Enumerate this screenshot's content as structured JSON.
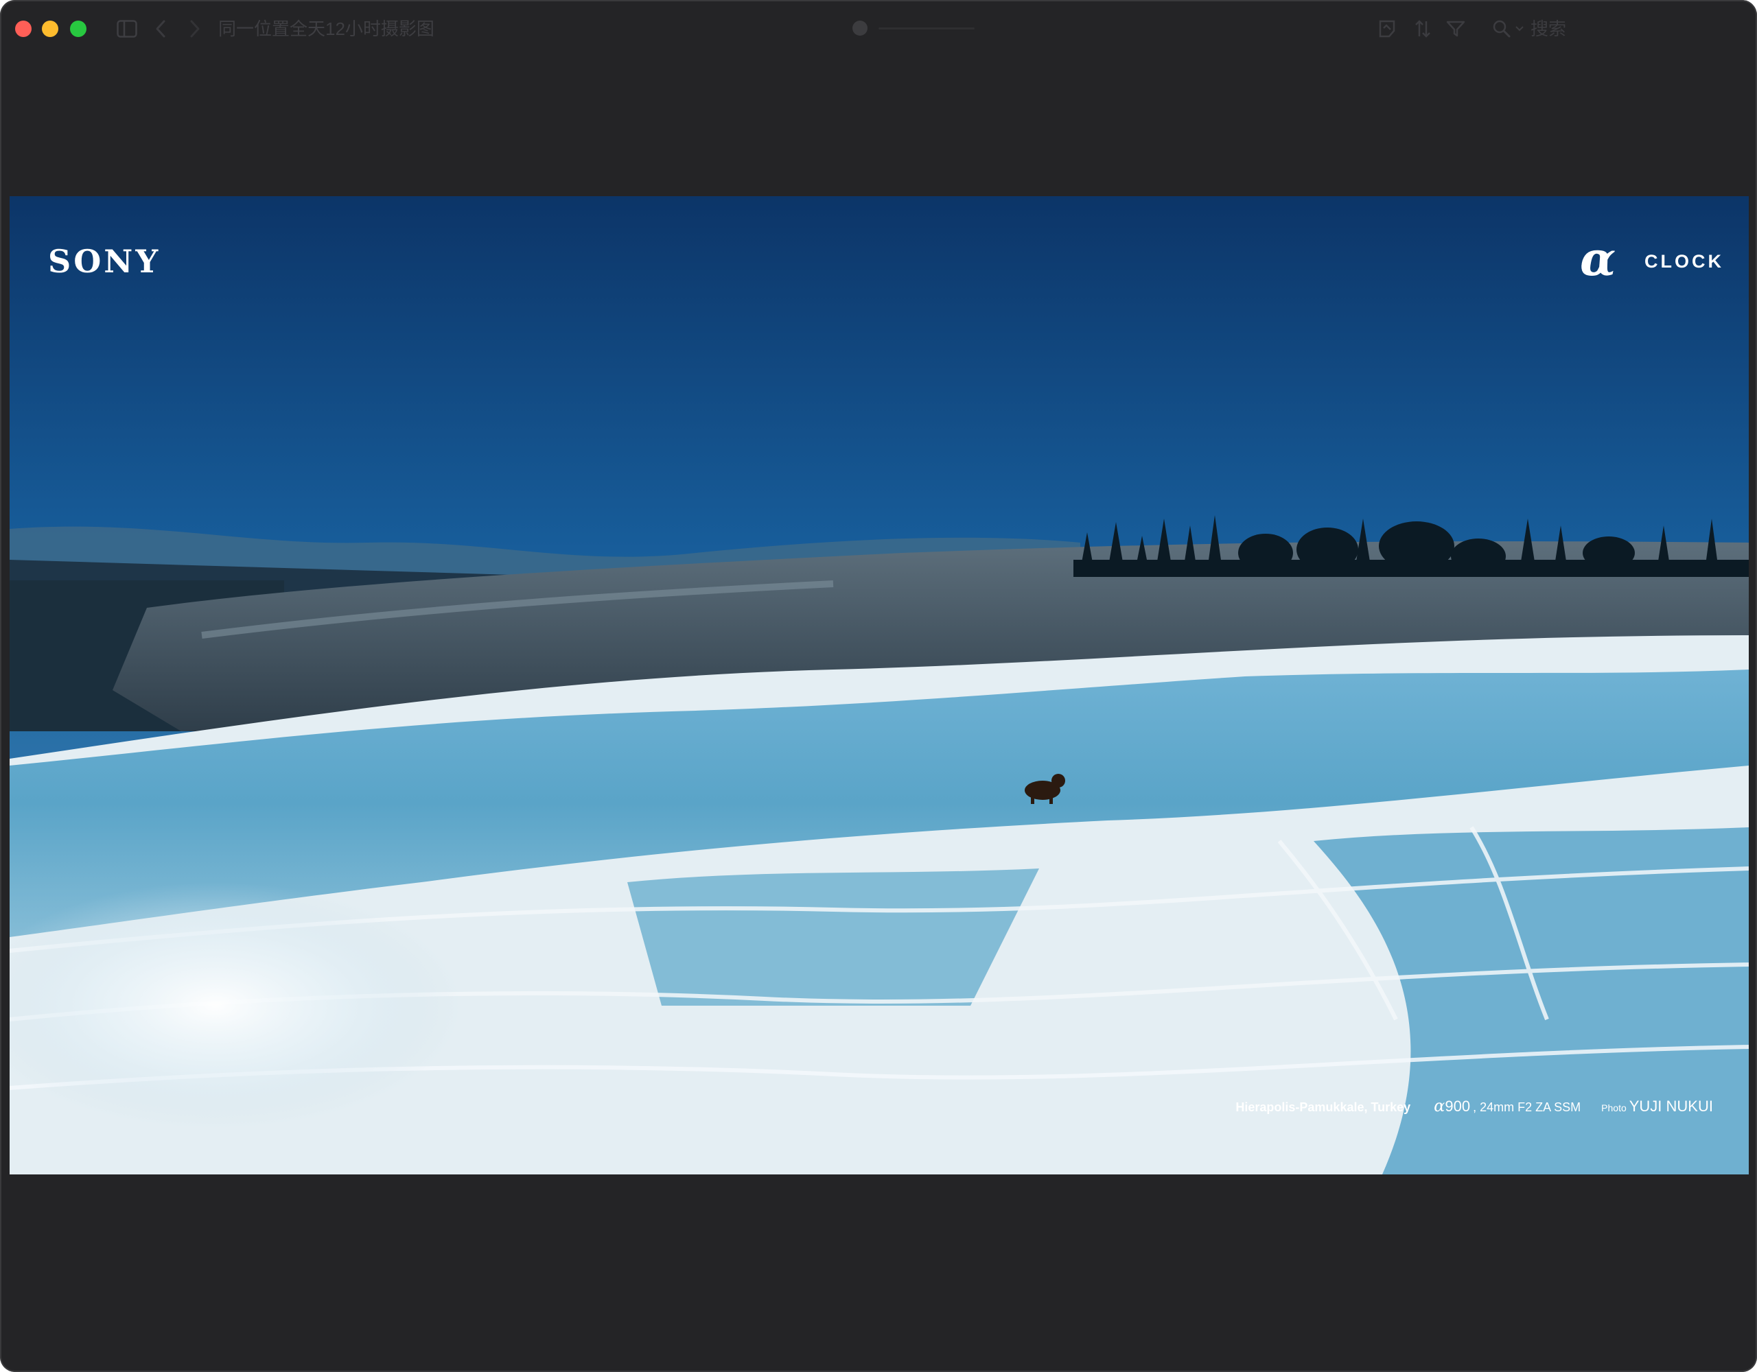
{
  "window": {
    "title": "同一位置全天12小时摄影图",
    "search": {
      "placeholder": "搜索",
      "value": ""
    }
  },
  "toolbar": {
    "icons": [
      "sidebar-toggle-icon",
      "back-icon",
      "forward-icon",
      "markup-icon",
      "sort-icon",
      "filter-icon",
      "search-icon"
    ]
  },
  "photo": {
    "brand": "SONY",
    "logo_alpha": "α",
    "logo_text": "CLOCK",
    "caption": {
      "location": "Hierapolis-Pamukkale, Turkey",
      "alpha": "α",
      "model": "900",
      "lens": ", 24mm F2 ZA SSM",
      "photo_label": "Photo",
      "photographer": "YUJI NUKUI"
    }
  },
  "colors": {
    "window_bg": "#242426",
    "close": "#ff5f57",
    "minimize": "#febc2e",
    "maximize": "#28c840"
  }
}
